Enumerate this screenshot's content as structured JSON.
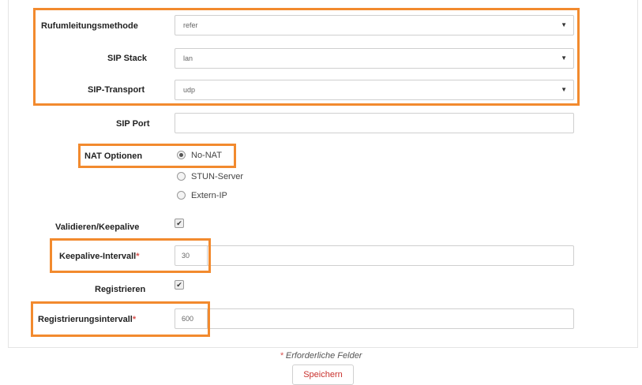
{
  "form": {
    "call_forwarding": {
      "label": "Rufumleitungsmethode",
      "value": "refer"
    },
    "sip_stack": {
      "label": "SIP Stack",
      "value": "lan"
    },
    "sip_transport": {
      "label": "SIP-Transport",
      "value": "udp"
    },
    "sip_port": {
      "label": "SIP Port",
      "value": ""
    },
    "nat": {
      "label": "NAT Optionen",
      "options": [
        "No-NAT",
        "STUN-Server",
        "Extern-IP"
      ],
      "selected": "No-NAT"
    },
    "validate_keepalive": {
      "label": "Validieren/Keepalive",
      "checked": true,
      "check_mark": "✔"
    },
    "keepalive_interval": {
      "label": "Keepalive-Intervall",
      "value": "30",
      "required_mark": "*"
    },
    "register": {
      "label": "Registrieren",
      "checked": true,
      "check_mark": "✔"
    },
    "register_interval": {
      "label": "Registrierungsintervall",
      "value": "600",
      "required_mark": "*"
    }
  },
  "footer": {
    "required_mark": "*",
    "required_note": "Erforderliche Felder",
    "save_label": "Speichern"
  },
  "icons": {
    "dropdown": "chevron-down-icon"
  },
  "colors": {
    "highlight": "#f28a2e",
    "required": "#d9534f",
    "save_text": "#c9302c"
  }
}
